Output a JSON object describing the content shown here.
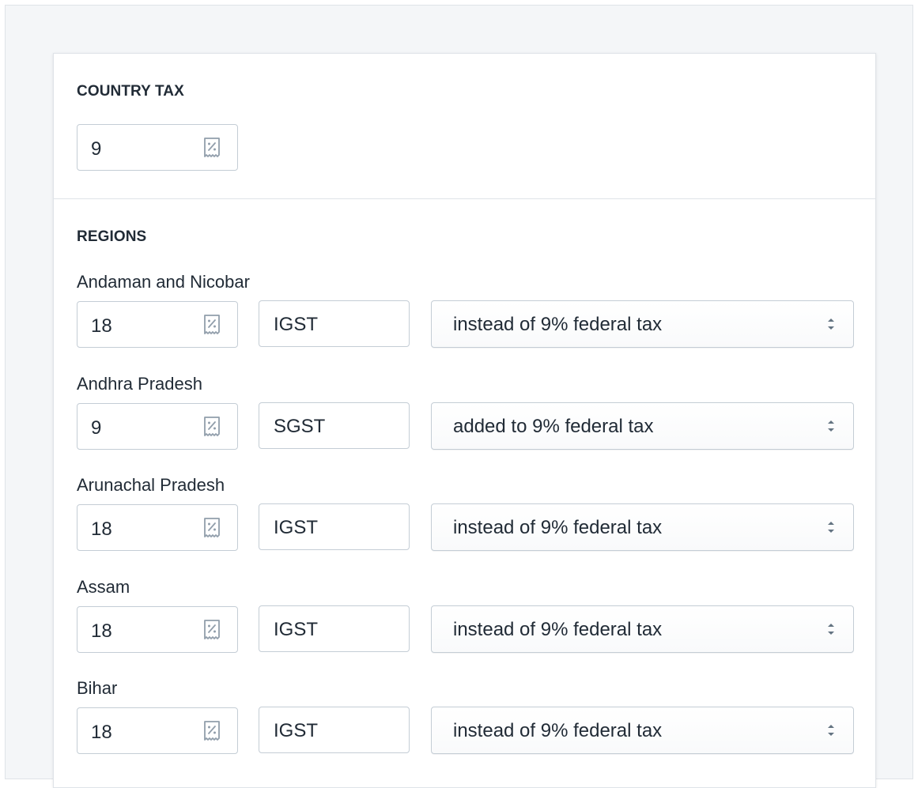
{
  "country_tax": {
    "heading": "COUNTRY TAX",
    "rate": "9"
  },
  "regions": {
    "heading": "REGIONS",
    "items": [
      {
        "name": "Andaman and Nicobar",
        "rate": "18",
        "tax_name": "IGST",
        "mode": "instead of 9% federal tax"
      },
      {
        "name": "Andhra Pradesh",
        "rate": "9",
        "tax_name": "SGST",
        "mode": "added to 9% federal tax"
      },
      {
        "name": "Arunachal Pradesh",
        "rate": "18",
        "tax_name": "IGST",
        "mode": "instead of 9% federal tax"
      },
      {
        "name": "Assam",
        "rate": "18",
        "tax_name": "IGST",
        "mode": "instead of 9% federal tax"
      },
      {
        "name": "Bihar",
        "rate": "18",
        "tax_name": "IGST",
        "mode": "instead of 9% federal tax"
      }
    ]
  },
  "icons": {
    "rate_icon": "receipt-percent-icon",
    "select_caret": "select-caret-icon"
  },
  "colors": {
    "border": "#c4cdd5",
    "text": "#212b36",
    "icon": "#919eab",
    "background": "#f4f6f8"
  }
}
